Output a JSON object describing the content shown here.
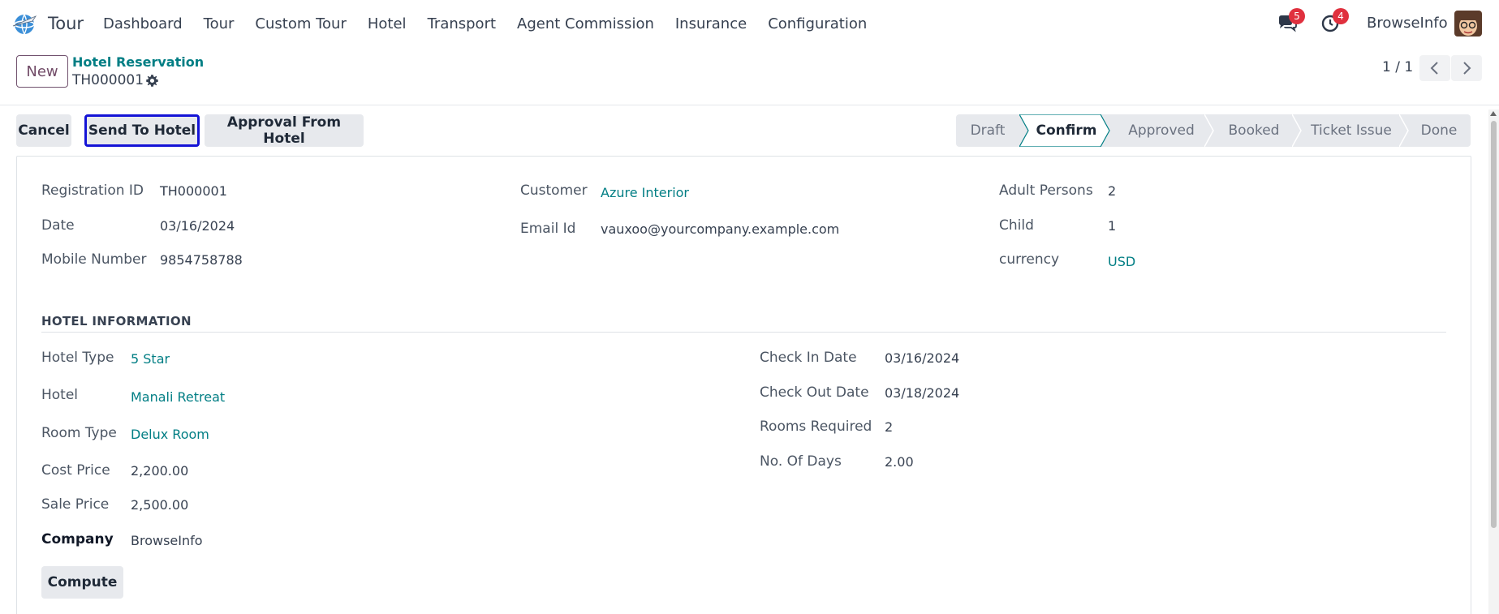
{
  "navbar": {
    "app_name": "Tour",
    "menu": [
      "Dashboard",
      "Tour",
      "Custom Tour",
      "Hotel",
      "Transport",
      "Agent Commission",
      "Insurance",
      "Configuration"
    ],
    "messages_count": "5",
    "activities_count": "4",
    "user_name": "BrowseInfo"
  },
  "control": {
    "new_label": "New",
    "breadcrumb_parent": "Hotel Reservation",
    "breadcrumb_current": "TH000001",
    "pager": "1 / 1"
  },
  "statusbar": {
    "actions": [
      "Cancel",
      "Send To Hotel",
      "Approval From Hotel"
    ],
    "stages": [
      "Draft",
      "Confirm",
      "Approved",
      "Booked",
      "Ticket Issue",
      "Done"
    ],
    "active_stage": "Confirm"
  },
  "form": {
    "registration_id": {
      "label": "Registration ID",
      "value": "TH000001"
    },
    "date": {
      "label": "Date",
      "value": "03/16/2024"
    },
    "mobile": {
      "label": "Mobile Number",
      "value": "9854758788"
    },
    "customer": {
      "label": "Customer",
      "value": "Azure Interior"
    },
    "email": {
      "label": "Email Id",
      "value": "vauxoo@yourcompany.example.com"
    },
    "adult": {
      "label": "Adult Persons",
      "value": "2"
    },
    "child": {
      "label": "Child",
      "value": "1"
    },
    "currency": {
      "label": "currency",
      "value": "USD"
    }
  },
  "hotel": {
    "section_title": "HOTEL INFORMATION",
    "hotel_type": {
      "label": "Hotel Type",
      "value": "5 Star"
    },
    "hotel": {
      "label": "Hotel",
      "value": "Manali Retreat"
    },
    "room_type": {
      "label": "Room Type",
      "value": "Delux Room"
    },
    "cost_price": {
      "label": "Cost Price",
      "value": "2,200.00"
    },
    "sale_price": {
      "label": "Sale Price",
      "value": "2,500.00"
    },
    "company": {
      "label": "Company",
      "value": "BrowseInfo"
    },
    "check_in": {
      "label": "Check In Date",
      "value": "03/16/2024"
    },
    "check_out": {
      "label": "Check Out Date",
      "value": "03/18/2024"
    },
    "rooms": {
      "label": "Rooms Required",
      "value": "2"
    },
    "days": {
      "label": "No. Of Days",
      "value": "2.00"
    },
    "compute_label": "Compute"
  },
  "colors": {
    "link": "#017e84",
    "primary": "#714b67",
    "focus_border": "#1413d6",
    "badge": "#e0303e"
  }
}
